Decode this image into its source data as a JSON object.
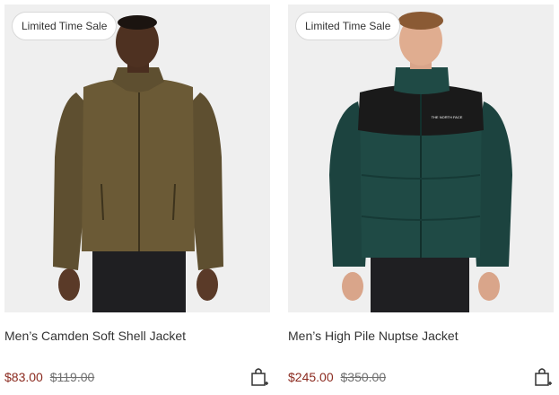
{
  "products": [
    {
      "badge": "Limited Time Sale",
      "name": "Men’s Camden Soft Shell Jacket",
      "sale_price": "$83.00",
      "original_price": "$119.00",
      "jacket_color": "#6b5a36"
    },
    {
      "badge": "Limited Time Sale",
      "name": "Men’s High Pile Nuptse Jacket",
      "sale_price": "$245.00",
      "original_price": "$350.00",
      "jacket_color": "#1f4a45",
      "logo_text": "THE NORTH FACE"
    }
  ],
  "colors": {
    "sale_price": "#8b2a1f",
    "original_price": "#707070",
    "image_bg": "#efefef"
  },
  "icons": [
    "add-to-bag-icon"
  ]
}
